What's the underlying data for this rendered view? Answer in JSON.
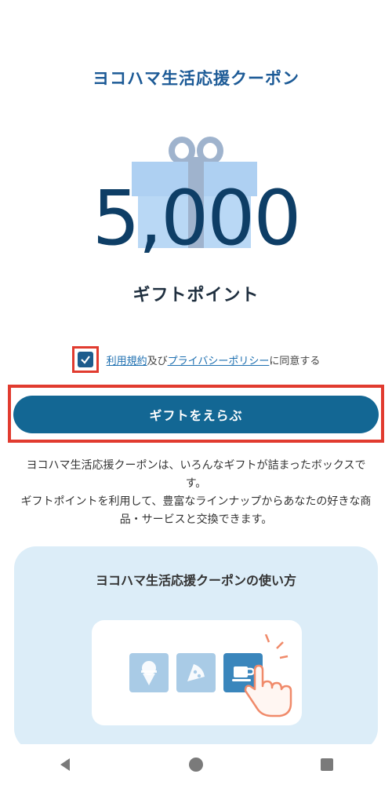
{
  "header": {
    "title": "ヨコハマ生活応援クーポン"
  },
  "hero": {
    "amount": "5,000",
    "unit_label": "ギフトポイント"
  },
  "agreement": {
    "checked": true,
    "terms_link": "利用規約",
    "connector": "及び",
    "privacy_link": "プライバシーポリシー",
    "suffix": "に同意する"
  },
  "cta": {
    "label": "ギフトをえらぶ"
  },
  "description": {
    "line1": "ヨコハマ生活応援クーポンは、いろんなギフトが詰まったボックスです。",
    "line2": "ギフトポイントを利用して、豊富なラインナップからあなたの好きな商品・サービスと交換できます。"
  },
  "howto": {
    "title": "ヨコハマ生活応援クーポンの使い方",
    "icons": [
      "ice-cream-icon",
      "pizza-icon",
      "coffee-cup-icon",
      "pointing-hand-icon"
    ]
  },
  "colors": {
    "title": "#1c5a96",
    "amount": "#0e3e66",
    "button": "#136794",
    "highlight": "#e13b2f",
    "panel": "#dcedf8"
  },
  "navbar": {
    "icons": [
      "back-icon",
      "home-icon",
      "recents-icon"
    ]
  }
}
